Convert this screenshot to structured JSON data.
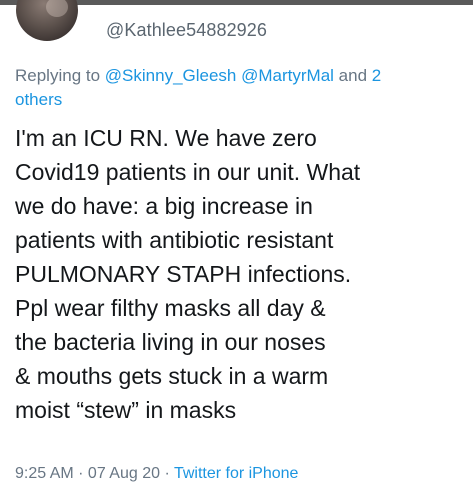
{
  "tweet": {
    "handle": "@Kathlee54882926",
    "reply": {
      "prefix": "Replying to ",
      "mention_1": "@Skinny_Gleesh",
      "mention_2": "@MartyrMal",
      "suffix_1": " and ",
      "others_link_1": "2",
      "others_link_2": "others"
    },
    "body_lines": [
      "I'm an ICU RN. We have zero",
      "Covid19 patients in our unit. What",
      "we do have: a big increase in",
      "patients with antibiotic resistant",
      "PULMONARY STAPH infections.",
      "Ppl wear filthy masks all day &",
      "the bacteria living in our noses",
      "& mouths gets stuck in a warm",
      "moist “stew” in masks"
    ],
    "time": "9:25 AM",
    "sep_1": " · ",
    "date": "07 Aug 20",
    "sep_2": " · ",
    "source": "Twitter for iPhone"
  },
  "colors": {
    "link": "#1b95e0",
    "secondary_text": "#687684",
    "primary_text": "#14171a"
  }
}
